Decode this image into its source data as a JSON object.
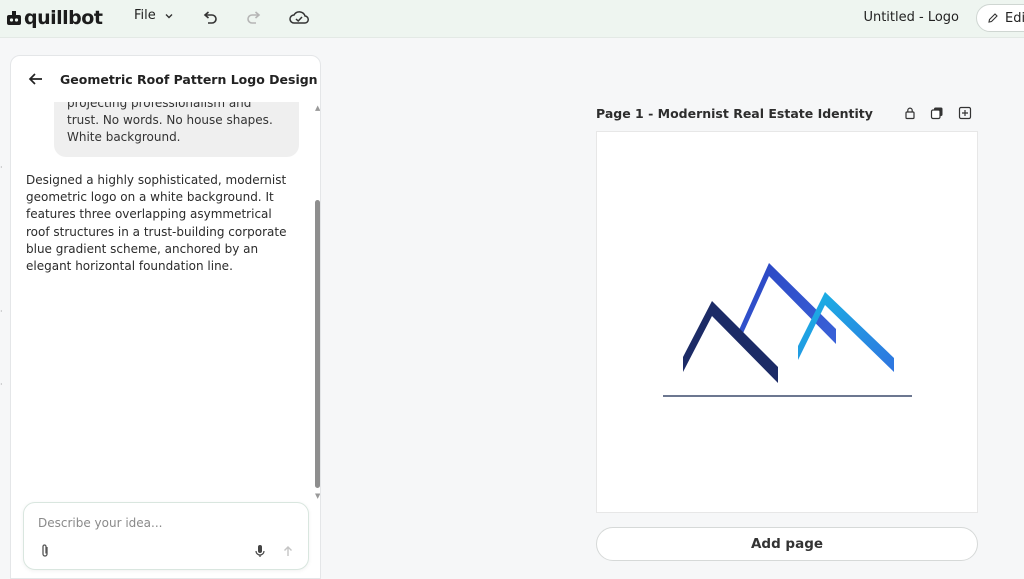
{
  "app": {
    "brand": "quillbot",
    "file_menu": "File",
    "document_title": "Untitled - Logo",
    "edit_label": "Edi"
  },
  "chat": {
    "title": "Geometric Roof Pattern Logo Design",
    "user_message_visible": "projecting professionalism and trust. No words. No house shapes. White background.",
    "assistant_message": "Designed a highly sophisticated, modernist geometric logo on a white background. It features three overlapping asymmetrical roof structures in a trust-building corporate blue gradient scheme, anchored by an elegant horizontal foundation line.",
    "input_placeholder": "Describe your idea..."
  },
  "canvas": {
    "page_label": "Page 1 - Modernist Real Estate Identity",
    "add_page_label": "Add page"
  },
  "colors": {
    "navy": "#1c2b66",
    "royal": "#2f4fc8",
    "cyan": "#1aaee0",
    "foundation": "#3b4a6b",
    "topbar": "#eef5f0"
  },
  "icons": {
    "undo": "undo-icon",
    "redo": "redo-icon",
    "cloud": "cloud-check-icon",
    "lock": "lock-icon",
    "duplicate": "duplicate-icon",
    "add": "add-page-icon"
  }
}
